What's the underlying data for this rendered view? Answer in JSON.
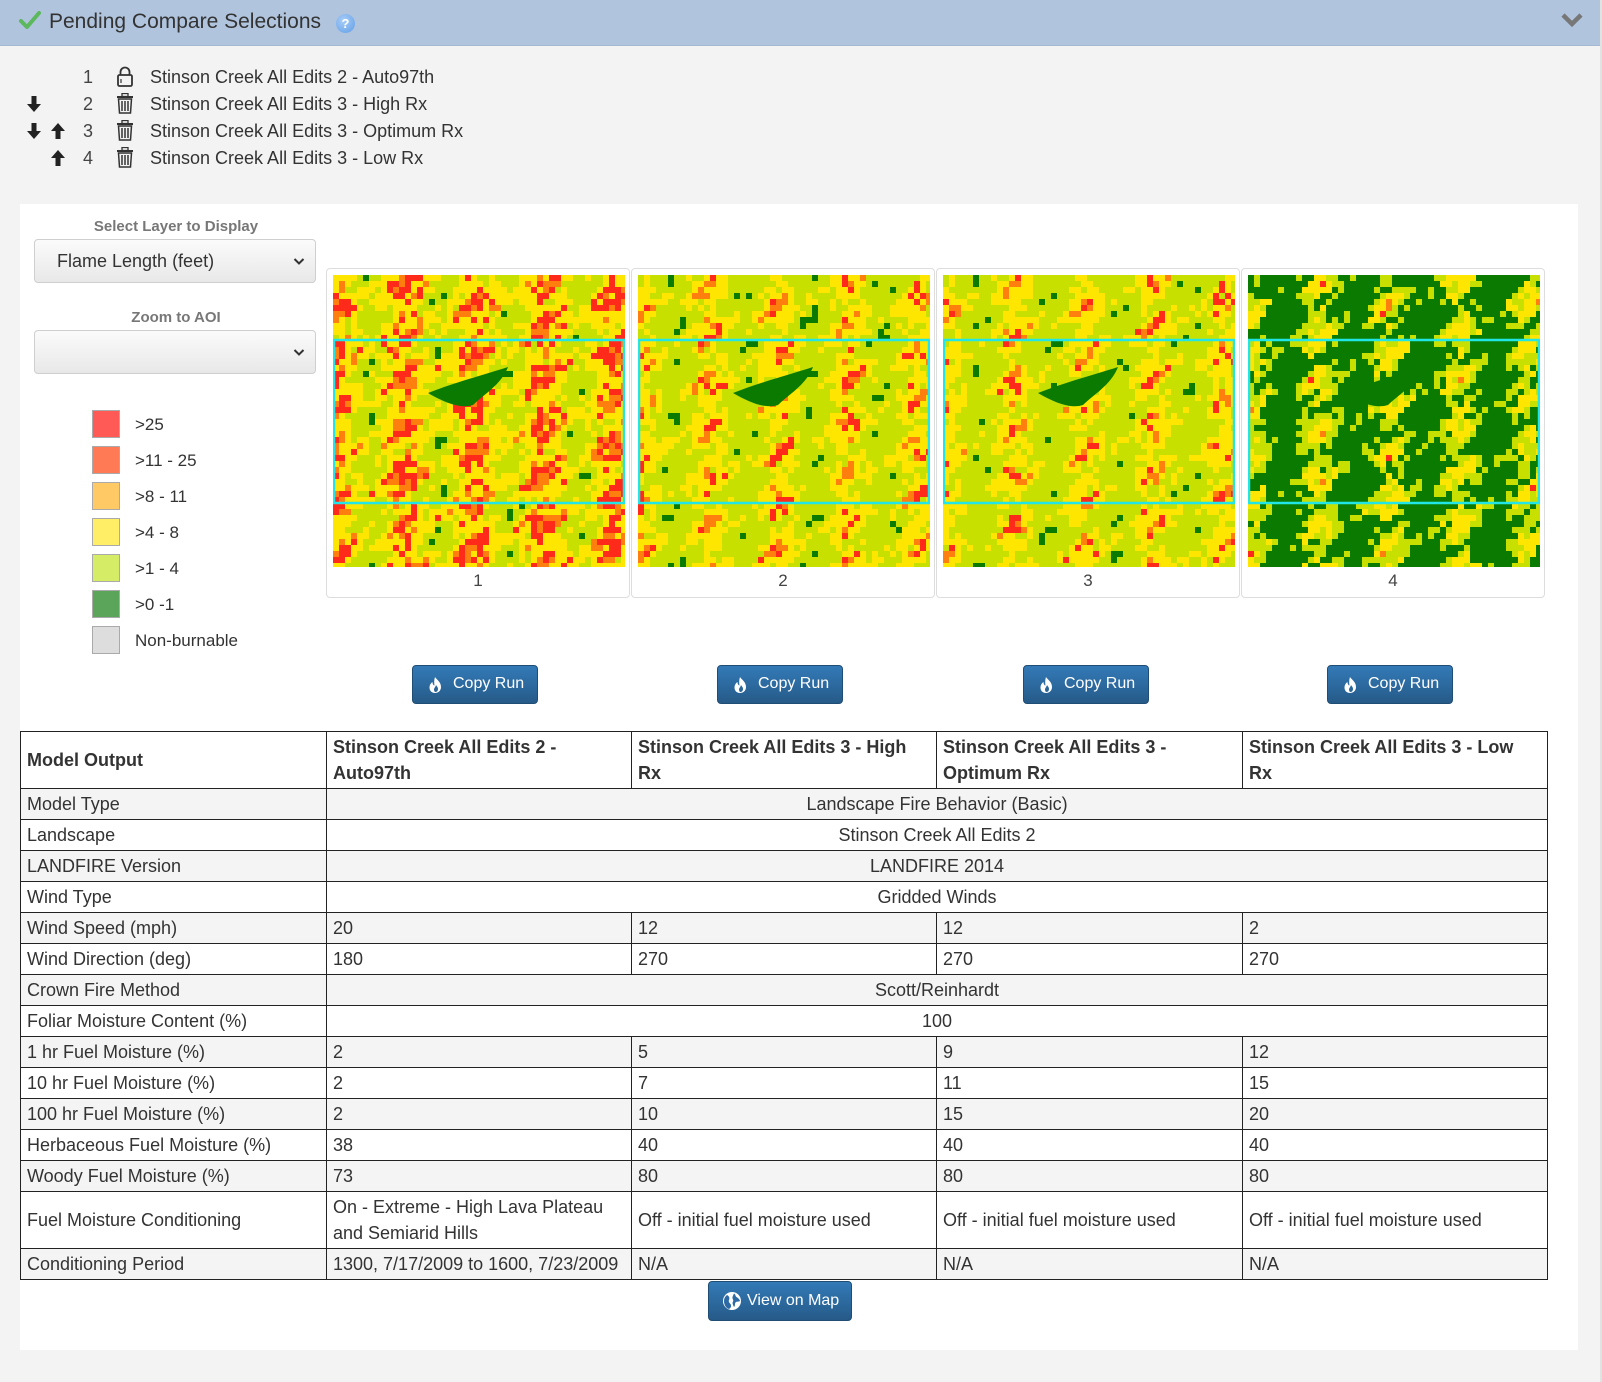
{
  "header": {
    "title": "Pending Compare Selections",
    "help_label": "?",
    "accent": "#b0c4de"
  },
  "selections": [
    {
      "index": "1",
      "name": "Stinson Creek All Edits 2 - Auto97th",
      "action_icon": "lock-icon",
      "can_move_down": false,
      "can_move_up": false
    },
    {
      "index": "2",
      "name": "Stinson Creek All Edits 3 - High Rx",
      "action_icon": "trash-icon",
      "can_move_down": true,
      "can_move_up": false
    },
    {
      "index": "3",
      "name": "Stinson Creek All Edits 3 - Optimum Rx",
      "action_icon": "trash-icon",
      "can_move_down": true,
      "can_move_up": true
    },
    {
      "index": "4",
      "name": "Stinson Creek All Edits 3 - Low Rx",
      "action_icon": "trash-icon",
      "can_move_down": false,
      "can_move_up": true
    }
  ],
  "controls": {
    "layer_label": "Select Layer to Display",
    "layer_value": "Flame Length (feet)",
    "aoi_label": "Zoom to AOI",
    "aoi_value": ""
  },
  "legend": [
    {
      "label": ">25",
      "color": "#ff5a55"
    },
    {
      "label": ">11 - 25",
      "color": "#ff7a55"
    },
    {
      "label": ">8 - 11",
      "color": "#ffc966"
    },
    {
      "label": ">4 - 8",
      "color": "#ffee66"
    },
    {
      "label": ">1 - 4",
      "color": "#d4ec66"
    },
    {
      "label": ">0 -1",
      "color": "#5aa55a"
    },
    {
      "label": "Non-burnable",
      "color": "#dddddd"
    }
  ],
  "maps": [
    {
      "label": "1",
      "green_share": 0.08,
      "red_share": 0.35
    },
    {
      "label": "2",
      "green_share": 0.12,
      "red_share": 0.22
    },
    {
      "label": "3",
      "green_share": 0.1,
      "red_share": 0.2
    },
    {
      "label": "4",
      "green_share": 0.55,
      "red_share": 0.04
    }
  ],
  "map_colors": {
    "red": "#ff2a1a",
    "orange": "#ff7f0e",
    "yellow": "#ffe600",
    "lime": "#c8e000",
    "green": "#0a7a00",
    "aoi": "#22e5e8"
  },
  "copy_run_label": "Copy Run",
  "table": {
    "header": [
      "Model Output",
      "Stinson Creek All Edits 2 - Auto97th",
      "Stinson Creek All Edits 3 - High Rx",
      "Stinson Creek All Edits 3 - Optimum Rx",
      "Stinson Creek All Edits 3 - Low Rx"
    ],
    "rows": [
      {
        "label": "Model Type",
        "span": "Landscape Fire Behavior (Basic)"
      },
      {
        "label": "Landscape",
        "span": "Stinson Creek All Edits 2"
      },
      {
        "label": "LANDFIRE Version",
        "span": "LANDFIRE 2014"
      },
      {
        "label": "Wind Type",
        "span": "Gridded Winds"
      },
      {
        "label": "Wind Speed (mph)",
        "values": [
          "20",
          "12",
          "12",
          "2"
        ]
      },
      {
        "label": "Wind Direction (deg)",
        "values": [
          "180",
          "270",
          "270",
          "270"
        ]
      },
      {
        "label": "Crown Fire Method",
        "span": "Scott/Reinhardt"
      },
      {
        "label": "Foliar Moisture Content (%)",
        "span": "100"
      },
      {
        "label": "1 hr Fuel Moisture (%)",
        "values": [
          "2",
          "5",
          "9",
          "12"
        ]
      },
      {
        "label": "10 hr Fuel Moisture (%)",
        "values": [
          "2",
          "7",
          "11",
          "15"
        ]
      },
      {
        "label": "100 hr Fuel Moisture (%)",
        "values": [
          "2",
          "10",
          "15",
          "20"
        ]
      },
      {
        "label": "Herbaceous Fuel Moisture (%)",
        "values": [
          "38",
          "40",
          "40",
          "40"
        ]
      },
      {
        "label": "Woody Fuel Moisture (%)",
        "values": [
          "73",
          "80",
          "80",
          "80"
        ]
      },
      {
        "label": "Fuel Moisture Conditioning",
        "values": [
          "On - Extreme - High Lava Plateau and Semiarid Hills",
          "Off - initial fuel moisture used",
          "Off - initial fuel moisture used",
          "Off - initial fuel moisture used"
        ]
      },
      {
        "label": "Conditioning Period",
        "values": [
          "1300, 7/17/2009 to 1600, 7/23/2009",
          "N/A",
          "N/A",
          "N/A"
        ]
      }
    ]
  },
  "view_on_map_label": "View on Map"
}
